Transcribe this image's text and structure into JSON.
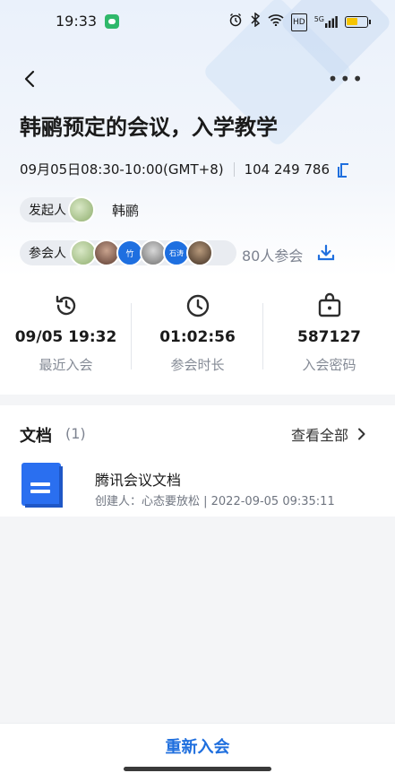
{
  "status_bar": {
    "time": "19:33",
    "alarm_icon": "alarm-icon",
    "bluetooth_icon": "bluetooth-icon",
    "wifi_icon": "wifi-icon",
    "hd_label": "HD",
    "signal_label": "5G",
    "battery_icon": "battery-icon"
  },
  "nav": {
    "back_icon": "back-arrow-icon",
    "more_icon": "more-icon",
    "more_label": "•••"
  },
  "meeting": {
    "title": "韩鹂预定的会议，入学教学",
    "time_range": "09月05日08:30-10:00(GMT+8)",
    "meeting_id": "104 249 786",
    "host_label": "发起人",
    "host_name": "韩鹂",
    "participants_label": "参会人",
    "participant_avatars": [
      "",
      "",
      "竹",
      "",
      "石涛",
      ""
    ],
    "participants_count": "80人参会"
  },
  "stats": [
    {
      "icon": "history-icon",
      "value": "09/05 19:32",
      "label": "最近入会"
    },
    {
      "icon": "clock-icon",
      "value": "01:02:56",
      "label": "参会时长"
    },
    {
      "icon": "lock-box-icon",
      "value": "587127",
      "label": "入会密码"
    }
  ],
  "documents": {
    "title": "文档",
    "count": "(1)",
    "view_all": "查看全部",
    "items": [
      {
        "name": "腾讯会议文档",
        "meta": "创建人：心态要放松 | 2022-09-05 09:35:11"
      }
    ]
  },
  "bottom": {
    "rejoin_label": "重新入会"
  },
  "colors": {
    "accent": "#1f6fde",
    "doc_icon": "#2a6ff0"
  }
}
